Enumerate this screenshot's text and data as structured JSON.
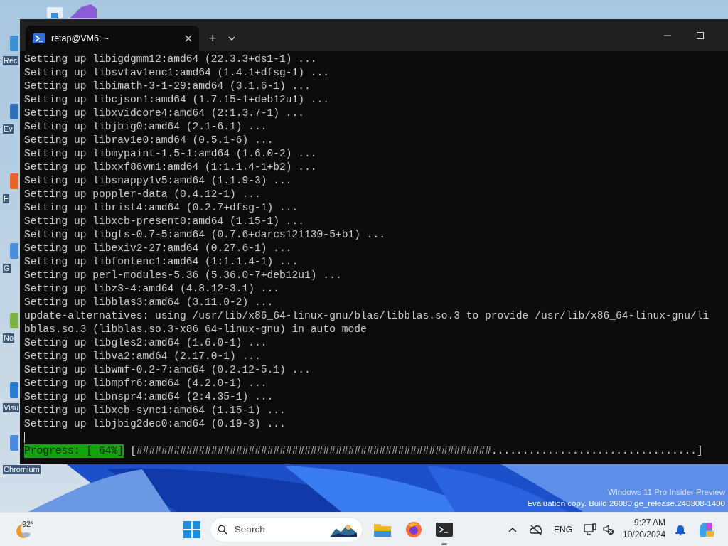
{
  "desktop": {
    "icons": [
      {
        "label": "Rec",
        "color": "#3b8fd6"
      },
      {
        "label": "Ev",
        "color": "#2f6fb5"
      },
      {
        "label": "F",
        "color": "#e8652a"
      },
      {
        "label": "G",
        "color": "#4a90d9"
      },
      {
        "label": "No",
        "color": "#7cb342"
      },
      {
        "label": "Visu",
        "color": "#2a7bd4"
      },
      {
        "label": "Chromium",
        "color": "#4a8be0"
      }
    ],
    "watermark": [
      "Windows 11 Pro Insider Preview",
      "Evaluation copy. Build 26080.ge_release.240308-1400"
    ]
  },
  "window": {
    "tabs": [
      {
        "title": "retap@VM6: ~",
        "selected": true
      }
    ],
    "new_tab": "+",
    "lines": [
      "Setting up libigdgmm12:amd64 (22.3.3+ds1-1) ...",
      "Setting up libsvtav1enc1:amd64 (1.4.1+dfsg-1) ...",
      "Setting up libimath-3-1-29:amd64 (3.1.6-1) ...",
      "Setting up libcjson1:amd64 (1.7.15-1+deb12u1) ...",
      "Setting up libxvidcore4:amd64 (2:1.3.7-1) ...",
      "Setting up libjbig0:amd64 (2.1-6.1) ...",
      "Setting up librav1e0:amd64 (0.5.1-6) ...",
      "Setting up libmypaint-1.5-1:amd64 (1.6.0-2) ...",
      "Setting up libxxf86vm1:amd64 (1:1.1.4-1+b2) ...",
      "Setting up libsnappy1v5:amd64 (1.1.9-3) ...",
      "Setting up poppler-data (0.4.12-1) ...",
      "Setting up librist4:amd64 (0.2.7+dfsg-1) ...",
      "Setting up libxcb-present0:amd64 (1.15-1) ...",
      "Setting up libgts-0.7-5:amd64 (0.7.6+darcs121130-5+b1) ...",
      "Setting up libexiv2-27:amd64 (0.27.6-1) ...",
      "Setting up libfontenc1:amd64 (1:1.1.4-1) ...",
      "Setting up perl-modules-5.36 (5.36.0-7+deb12u1) ...",
      "Setting up libz3-4:amd64 (4.8.12-3.1) ...",
      "Setting up libblas3:amd64 (3.11.0-2) ...",
      "update-alternatives: using /usr/lib/x86_64-linux-gnu/blas/libblas.so.3 to provide /usr/lib/x86_64-linux-gnu/li",
      "bblas.so.3 (libblas.so.3-x86_64-linux-gnu) in auto mode",
      "Setting up libgles2:amd64 (1.6.0-1) ...",
      "Setting up libva2:amd64 (2.17.0-1) ...",
      "Setting up libwmf-0.2-7:amd64 (0.2.12-5.1) ...",
      "Setting up libmpfr6:amd64 (4.2.0-1) ...",
      "Setting up libnspr4:amd64 (2:4.35-1) ...",
      "Setting up libxcb-sync1:amd64 (1.15-1) ...",
      "Setting up libjbig2dec0:amd64 (0.19-3) ..."
    ],
    "progress": {
      "label": "Progress: [ 64%]",
      "bar": "[#########################################################.................................]"
    }
  },
  "taskbar": {
    "weather": "92°",
    "search": {
      "placeholder": "Search"
    },
    "language": "ENG",
    "time": "9:27 AM",
    "date": "10/20/2024"
  }
}
